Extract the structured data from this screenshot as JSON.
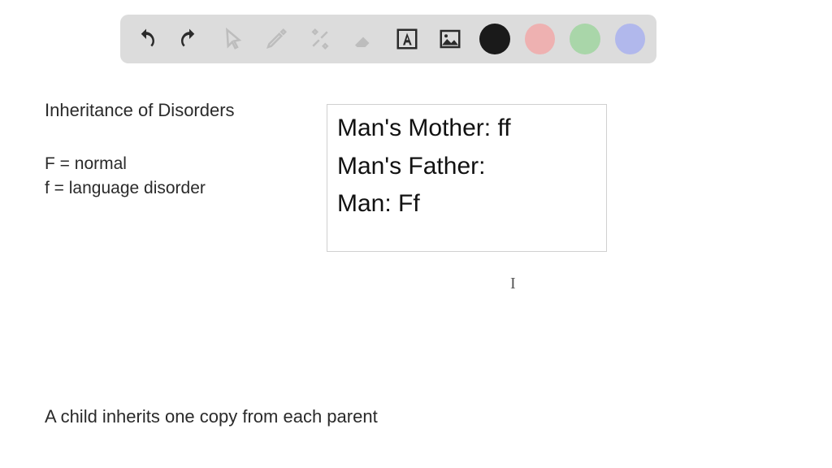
{
  "toolbar": {
    "colors": {
      "black": "#1a1a1a",
      "pink": "#eeb1b1",
      "green": "#a9d6a9",
      "blue": "#b1b8ec"
    }
  },
  "heading": "Inheritance of Disorders",
  "legend": {
    "line1": "F = normal",
    "line2": "f = language disorder"
  },
  "textbox": {
    "line1": "Man's Mother: ff",
    "line2": "Man's Father:",
    "line3": "Man:  Ff"
  },
  "bottom": "A child inherits one copy from each parent",
  "cursor_glyph": "I"
}
